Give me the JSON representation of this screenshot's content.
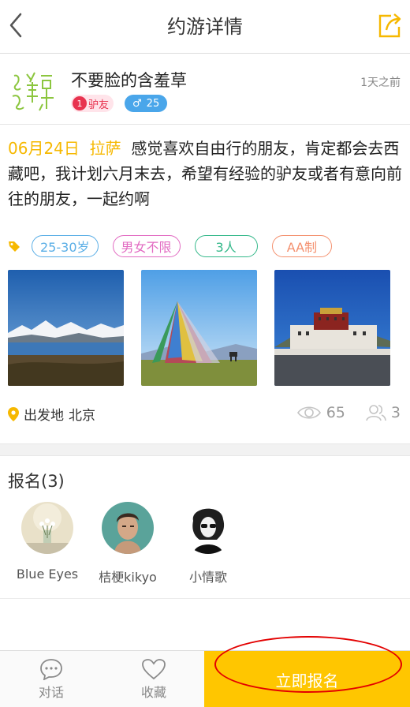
{
  "header": {
    "title": "约游详情",
    "back_icon": "chevron-left-icon",
    "share_icon": "share-icon",
    "accent_color": "#f6b800"
  },
  "user": {
    "name": "不要脸的含羞草",
    "badge_level": "1",
    "badge_label": "驴友",
    "gender_symbol": "♂",
    "age": "25",
    "time_ago": "1天之前"
  },
  "trip": {
    "date": "06月24日",
    "destination": "拉萨",
    "description": "感觉喜欢自由行的朋友，肯定都会去西藏吧，我计划六月末去，希望有经验的驴友或者有意向前往的朋友，一起约啊"
  },
  "tags": {
    "age_range": "25-30岁",
    "gender": "男女不限",
    "people": "3人",
    "payment": "AA制"
  },
  "location": {
    "label": "出发地",
    "city": "北京"
  },
  "stats": {
    "views": "65",
    "participants": "3"
  },
  "signup": {
    "title": "报名(3)",
    "members": [
      {
        "name": "Blue Eyes"
      },
      {
        "name": "桔梗kikyo"
      },
      {
        "name": "小情歌"
      }
    ]
  },
  "bottom_bar": {
    "chat_label": "对话",
    "favorite_label": "收藏",
    "join_label": "立即报名",
    "join_color": "#ffc600"
  }
}
